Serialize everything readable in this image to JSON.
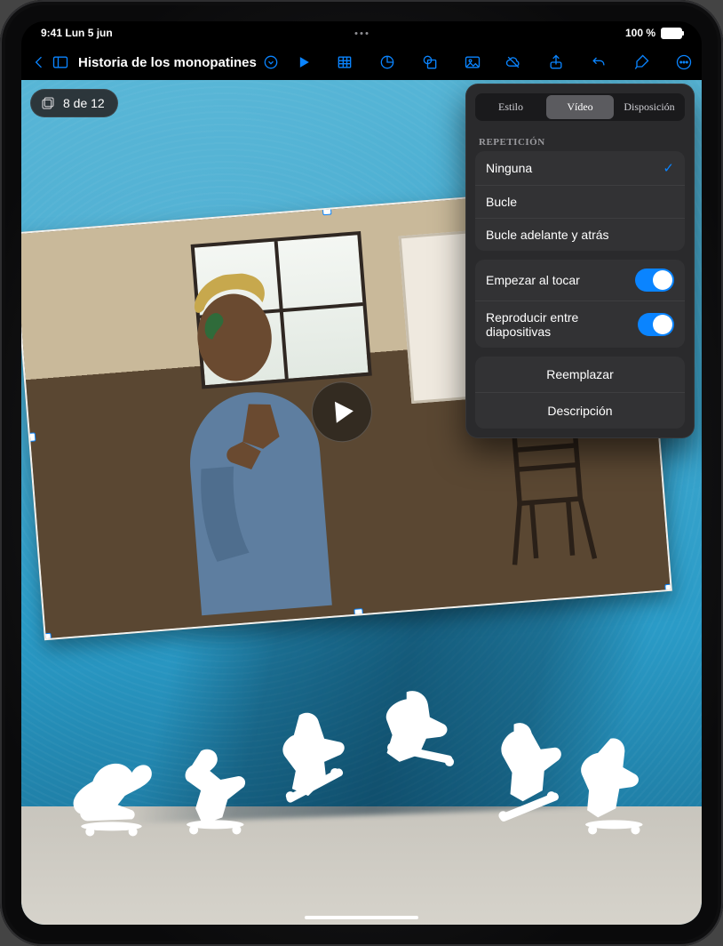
{
  "statusbar": {
    "time": "9:41",
    "date": "Lun 5 jun",
    "battery_text": "100 %"
  },
  "toolbar": {
    "doc_title": "Historia de los monopatines",
    "icons": {
      "back": "chevron-left",
      "sidebar": "sidebar",
      "dropdown": "chevron-down",
      "play": "play",
      "table": "table",
      "clock": "clock",
      "shape": "shape",
      "media": "image",
      "cloud": "cloud-off",
      "share": "share",
      "undo": "undo",
      "format": "paintbrush",
      "more": "ellipsis",
      "doc": "doc-settings"
    }
  },
  "slide_counter": {
    "label": "8 de 12"
  },
  "inspector": {
    "tabs": {
      "style": "Estilo",
      "video": "Vídeo",
      "layout": "Disposición",
      "active": "video"
    },
    "section_repeat_title": "REPETICIÓN",
    "repeat_options": {
      "none": "Ninguna",
      "loop": "Bucle",
      "loop_back_forth": "Bucle adelante y atrás",
      "selected": "none"
    },
    "toggles": {
      "start_on_tap": {
        "label": "Empezar al tocar",
        "value": true
      },
      "play_across": {
        "label": "Reproducir entre diapositivas",
        "value": true
      }
    },
    "actions": {
      "replace": "Reemplazar",
      "description": "Descripción"
    }
  }
}
